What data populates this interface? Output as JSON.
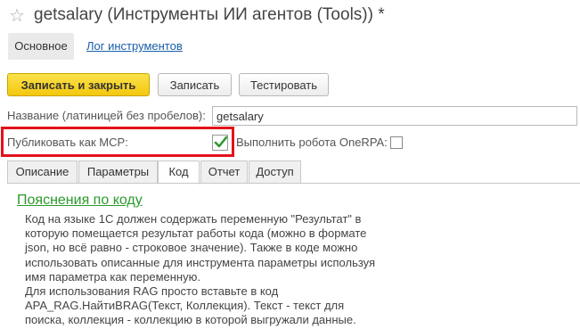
{
  "window": {
    "title": "getsalary (Инструменты ИИ агентов (Tools)) *"
  },
  "nav": {
    "main_tab": "Основное",
    "log_link": "Лог инструментов"
  },
  "toolbar": {
    "save_close": "Записать и закрыть",
    "save": "Записать",
    "test": "Тестировать"
  },
  "form": {
    "name_label": "Название (латиницей без пробелов):",
    "name_value": "getsalary",
    "mcp_label": "Публиковать как MCP:",
    "mcp_checked": true,
    "rpa_label": "Выполнить робота OneRPA:",
    "rpa_checked": false
  },
  "tabs": [
    {
      "label": "Описание",
      "active": false
    },
    {
      "label": "Параметры",
      "active": false
    },
    {
      "label": "Код",
      "active": true
    },
    {
      "label": "Отчет",
      "active": false
    },
    {
      "label": "Доступ",
      "active": false
    }
  ],
  "code_panel": {
    "title": "Пояснения по коду",
    "lines": [
      "Код на языке 1С должен содержать переменную \"Результат\" в",
      "которую помещается результат работы кода (можно в формате",
      "json, но всё равно - строковое значение). Также в коде можно",
      "использовать описанные для инструмента параметры используя",
      "имя параметра как переменную.",
      "Для использования RAG просто вставьте в код",
      "APA_RAG.НайтиВRAG(Текст, Коллекция). Текст - текст для",
      "поиска, коллекция - коллекцию в которой выгружали данные."
    ]
  },
  "colors": {
    "primary_button": "#f3c70d",
    "link": "#1a5ea8",
    "panel_title": "#2a9a2a",
    "highlight": "#e3121b",
    "checkmark": "#2e9a2e"
  }
}
